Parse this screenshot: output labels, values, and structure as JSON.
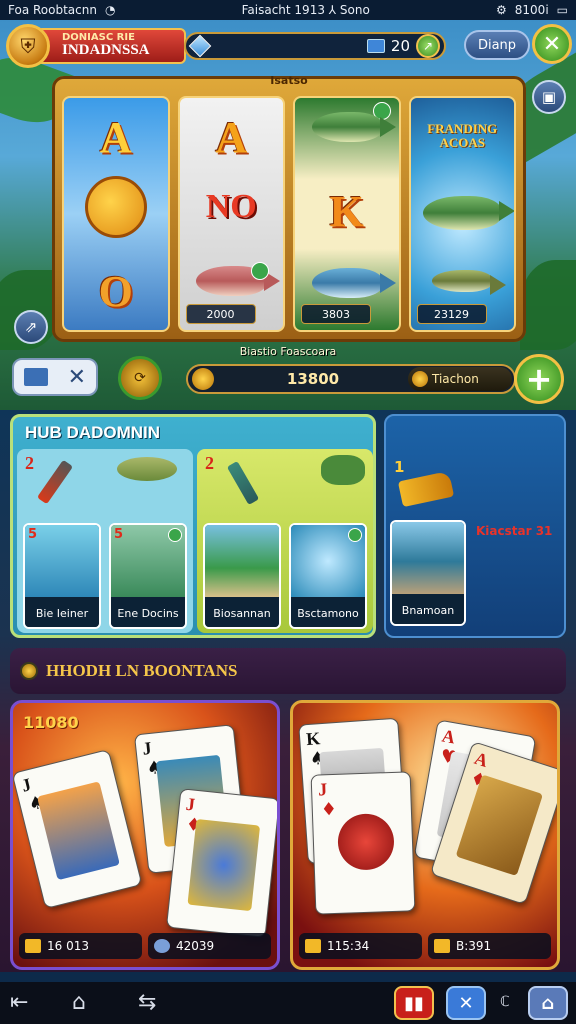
{
  "status_bar": {
    "left": "Foa Roobtacnn",
    "center": "Faisacht 1913 ⅄ Sono",
    "right": "8100i"
  },
  "header": {
    "logo_icon": "shield-crest-icon",
    "title_small": "DONIASC RIE",
    "title_big": "INDADNSSA",
    "gem_icon": "blue-gem-icon",
    "coin_count": "20",
    "chest_icon": "blue-chest-icon",
    "menu_label": "Dianp",
    "close_label": "✕"
  },
  "slot": {
    "label": "Isatso",
    "reels": [
      {
        "top": "A",
        "bottom": "O",
        "figure": "winged-sun-face"
      },
      {
        "top": "A",
        "middle": "NO",
        "value": "2000",
        "figure": "trout-fish"
      },
      {
        "middle": "K",
        "value": "3803",
        "figure": "perch-fish"
      },
      {
        "title": "FRANDING ACOAS",
        "value": "23129",
        "figure": "bass-fish"
      }
    ]
  },
  "bonus_caption": "Biastio Foascoara",
  "controls": {
    "bet_value": "13800",
    "sub_label": "Tiachon",
    "plus_label": "+"
  },
  "hub": {
    "title": "HUB DADOMNIN",
    "col_a": {
      "num": "2",
      "tiles": [
        {
          "num": "5",
          "caption": "Bie Ieiner"
        },
        {
          "num": "5",
          "caption": "Ene Docins"
        }
      ]
    },
    "col_b": {
      "num": "2",
      "tiles": [
        {
          "caption": "Biosannan"
        },
        {
          "caption": "Bsctamono"
        }
      ]
    },
    "side": {
      "num": "1",
      "label": "Kiacstar 31",
      "tile_caption": "Bnamoan"
    }
  },
  "tournaments": {
    "title": "HHODH LN BOONTANS",
    "left": {
      "score": "11080",
      "stat1": "16 013",
      "stat2": "42039"
    },
    "right": {
      "stat1": "115:34",
      "stat2": "B:391"
    }
  },
  "nav": {
    "back_icon": "back-icon",
    "home_icon": "home-icon",
    "recent_icon": "recent-apps-icon",
    "app_right_label": "ℂ"
  },
  "colors": {
    "accent_gold": "#f3c044",
    "hub_panel": "#3fb0cf",
    "green_button": "#3f9a24",
    "background": "#0d2a4a"
  }
}
